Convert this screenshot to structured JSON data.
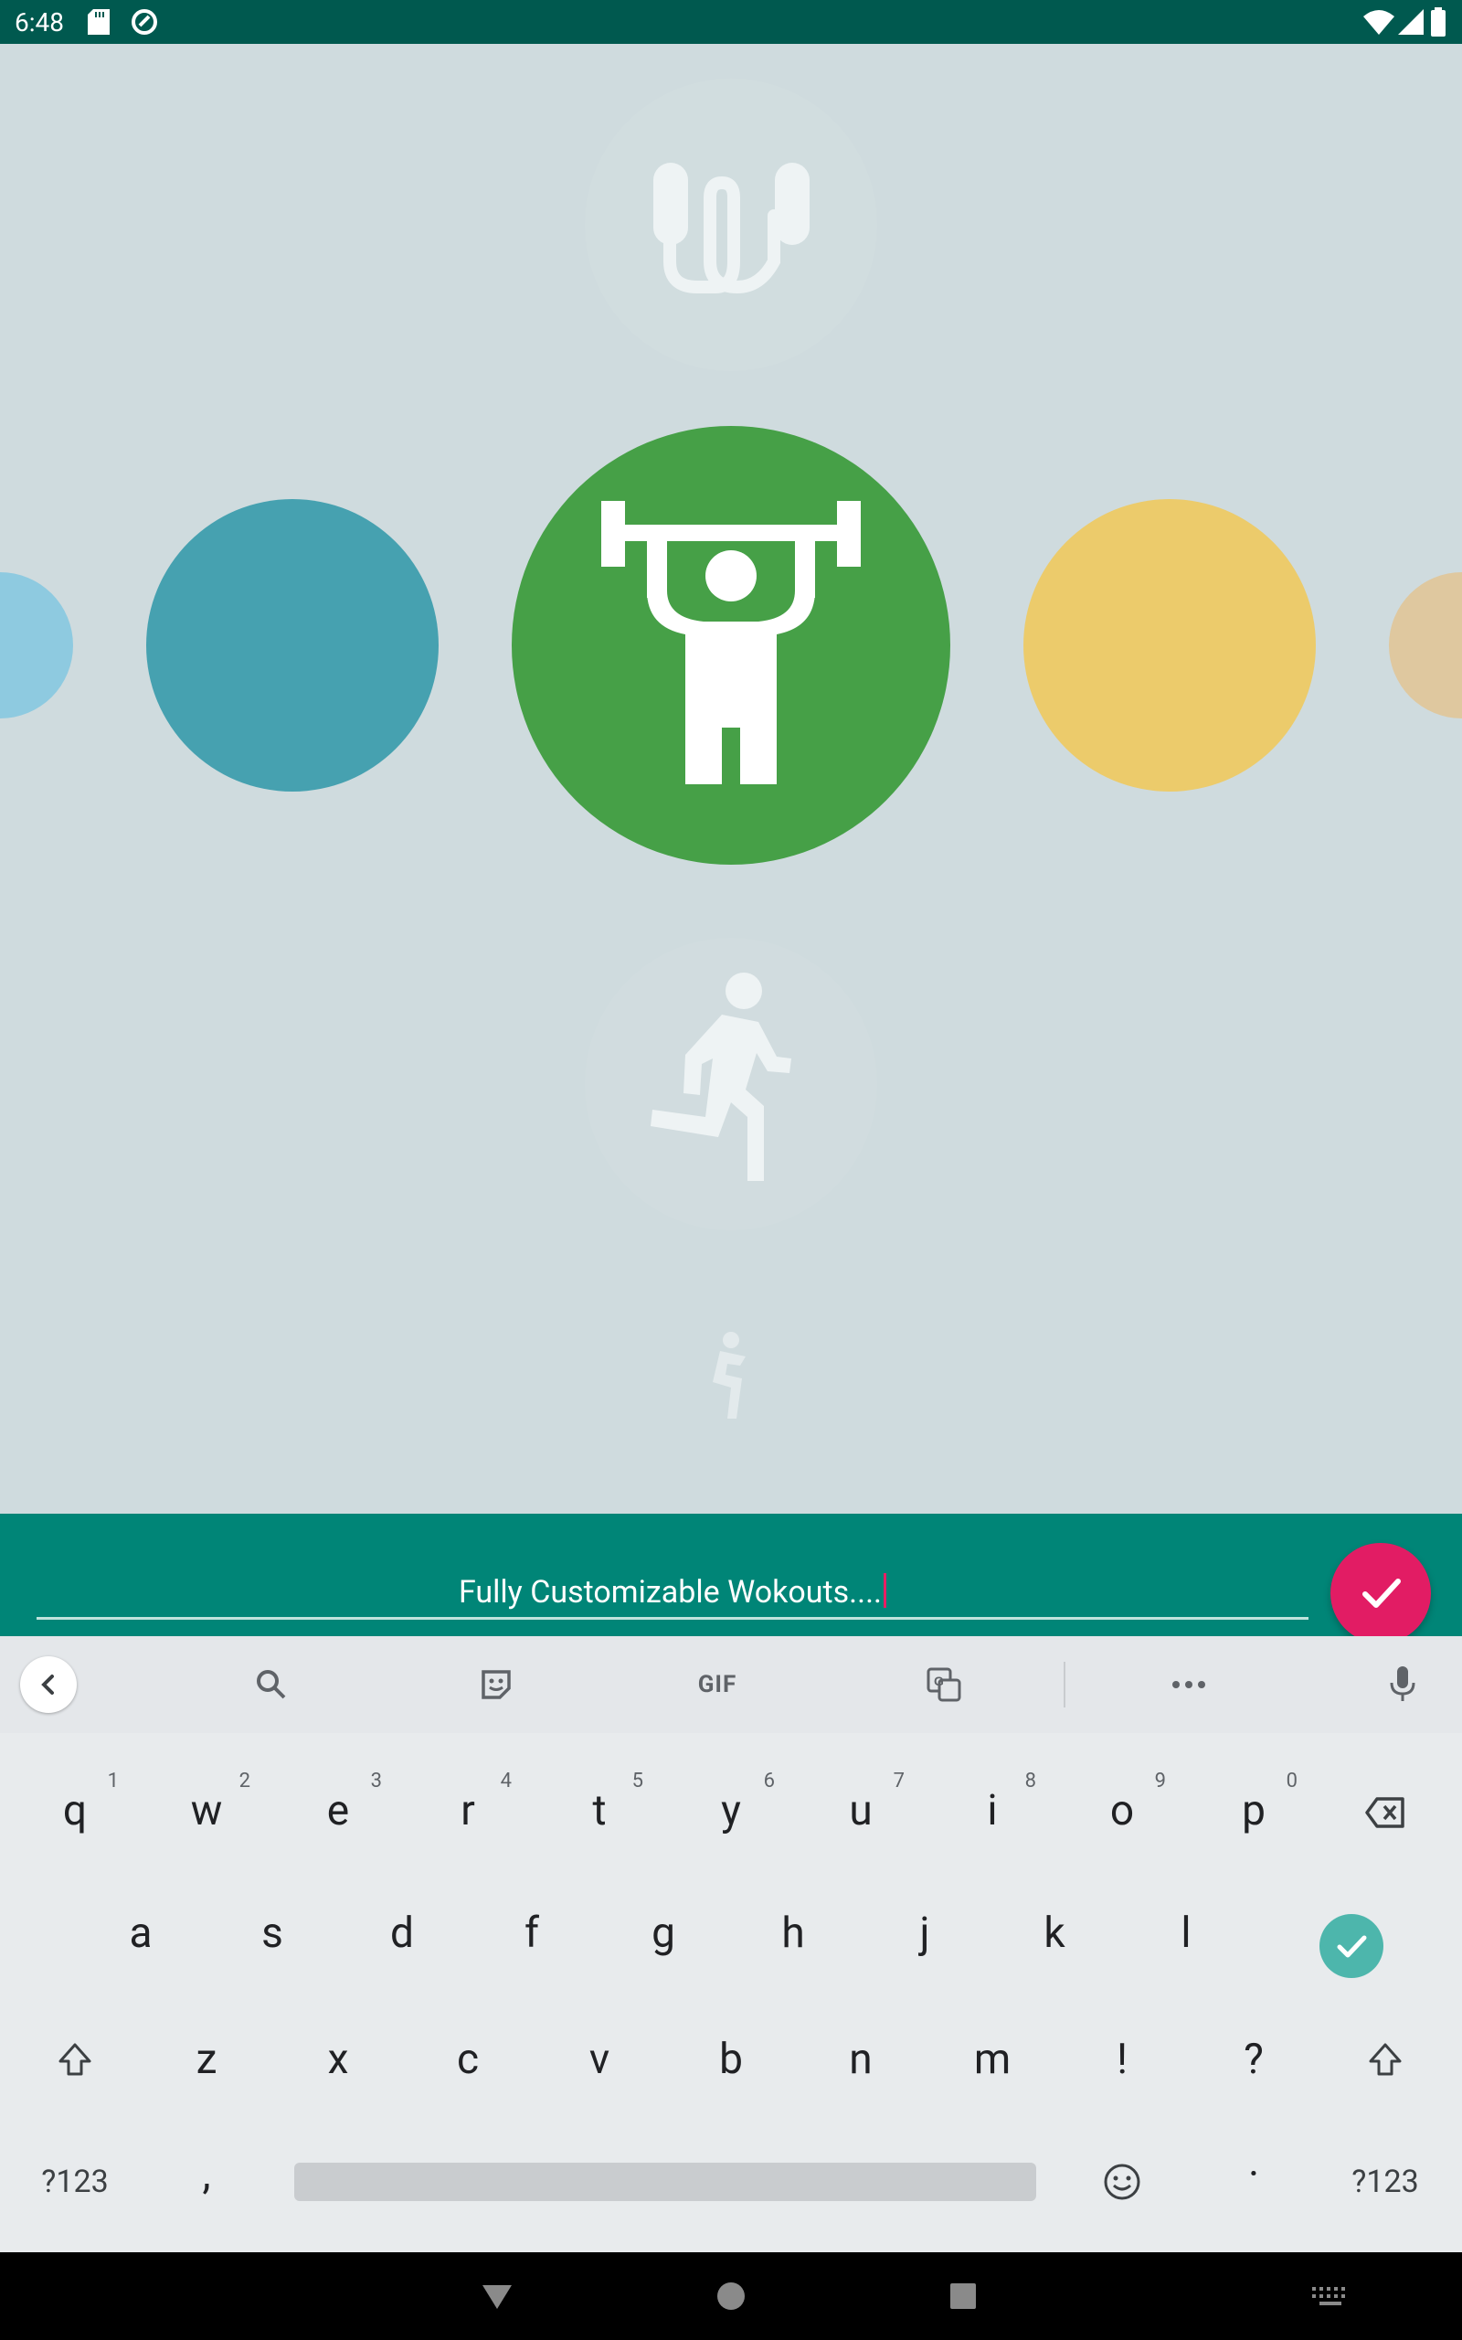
{
  "status_bar": {
    "time": "6:48"
  },
  "input": {
    "value": "Fully Customizable Wokouts...."
  },
  "keyboard": {
    "toolbar": [
      "back-icon",
      "search-icon",
      "sticker-icon",
      "gif",
      "translate-icon",
      "more-icon",
      "mic-icon"
    ],
    "gif_label": "GIF",
    "row1": [
      {
        "k": "q",
        "n": "1"
      },
      {
        "k": "w",
        "n": "2"
      },
      {
        "k": "e",
        "n": "3"
      },
      {
        "k": "r",
        "n": "4"
      },
      {
        "k": "t",
        "n": "5"
      },
      {
        "k": "y",
        "n": "6"
      },
      {
        "k": "u",
        "n": "7"
      },
      {
        "k": "i",
        "n": "8"
      },
      {
        "k": "o",
        "n": "9"
      },
      {
        "k": "p",
        "n": "0"
      }
    ],
    "row2": [
      "a",
      "s",
      "d",
      "f",
      "g",
      "h",
      "j",
      "k",
      "l"
    ],
    "row3": [
      "z",
      "x",
      "c",
      "v",
      "b",
      "n",
      "m",
      "!",
      "?"
    ],
    "sym_label": "?123",
    "comma": ",",
    "period": "·"
  },
  "colors": {
    "status": "#00594f",
    "background": "#cfdbde",
    "bar": "#008577",
    "fab": "#e21c64",
    "selected_circle": "#46a047",
    "teal_circle": "#46a1b0",
    "yellow_circle": "#eccb6b",
    "light_blue_circle": "#8ecae0",
    "tan_circle": "#dfc89f",
    "enter_key": "#4db6ac"
  }
}
